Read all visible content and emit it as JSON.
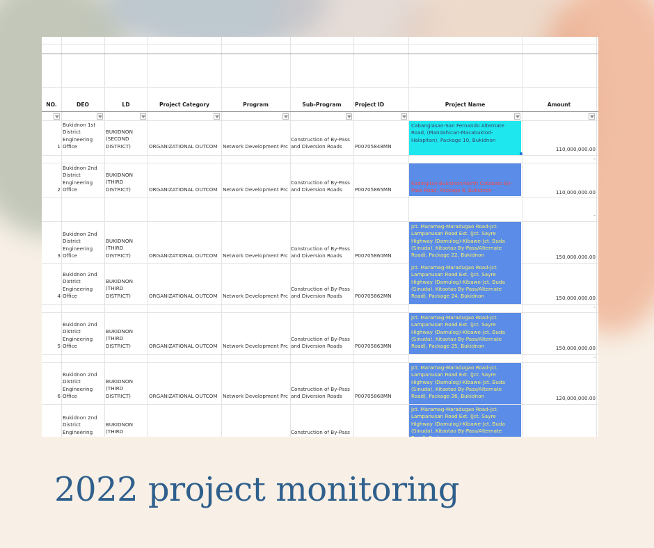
{
  "title": "2022 project monitoring",
  "colors": {
    "background": "#f8f0e6",
    "title": "#2f5f8c",
    "cyan_highlight": "#1ee8ee",
    "blue_highlight": "#5a8ce8",
    "yellow_text": "#fff36a",
    "red_text": "#f04b4b"
  },
  "sheet": {
    "headers": {
      "no": "NO.",
      "deo": "DEO",
      "ld": "LD",
      "category": "Project Category",
      "program": "Program",
      "subprogram": "Sub-Program",
      "project_id": "Project ID",
      "project_name": "Project Name",
      "amount": "Amount"
    },
    "separator": "-",
    "rows": [
      {
        "no": "1",
        "deo": "Bukidnon 1st\nDistrict\nEngineering\nOffice",
        "ld": "BUKIDNON\n(SECOND\nDISTRICT)",
        "category": "ORGANIZATIONAL OUTCOM",
        "program": "Network Development Prc",
        "subprogram": "Construction of By-Pass\nand Diversion Roads",
        "project_id": "P00705848MN",
        "project_name": "Cabanglasan-San Fernando Alternate Road, (Mandahican-Macabuklod-Halapitan), Package 10, Bukidnon",
        "amount": "110,000,000.00"
      },
      {
        "no": "2",
        "deo": "Bukidnon 2nd\nDistrict\nEngineering\nOffice",
        "ld": "BUKIDNON\n(THIRD\nDISTRICT)",
        "category": "ORGANIZATIONAL OUTCOM",
        "program": "Network Development Prc",
        "subprogram": "Construction of By-Pass\nand Diversion Roads",
        "project_id": "P00705865MN",
        "project_name": "Kadingilan-Bukidnon/North Cotabato By-Pass Road, Package 8, Bukidnon",
        "amount": "110,000,000.00"
      },
      {
        "no": "3",
        "deo": "Bukidnon 2nd\nDistrict\nEngineering\nOffice",
        "ld": "BUKIDNON\n(THIRD\nDISTRICT)",
        "category": "ORGANIZATIONAL OUTCOM",
        "program": "Network Development Prc",
        "subprogram": "Construction of By-Pass\nand Diversion Roads",
        "project_id": "P00705860MN",
        "project_name": "Jct. Maramag-Maradugao Road-Jct. Lampanusan Road Ext. (Jct. Sayre Highway (Damulog)-Kibawe-Jct. Buda (Sinuda), Kitaotao By-Pass/Alternate Road), Package 22, Bukidnon",
        "amount": "150,000,000.00"
      },
      {
        "no": "4",
        "deo": "Bukidnon 2nd\nDistrict\nEngineering\nOffice",
        "ld": "BUKIDNON\n(THIRD\nDISTRICT)",
        "category": "ORGANIZATIONAL OUTCOM",
        "program": "Network Development Prc",
        "subprogram": "Construction of By-Pass\nand Diversion Roads",
        "project_id": "P00705862MN",
        "project_name": "Jct. Maramag-Maradugao Road-Jct. Lampanusan Road Ext. (Jct. Sayre Highway (Damulog)-Kibawe-Jct. Buda (Sinuda), Kitaotao By-Pass/Alternate Road), Package 24, Bukidnon",
        "amount": "150,000,000.00"
      },
      {
        "no": "5",
        "deo": "Bukidnon 2nd\nDistrict\nEngineering\nOffice",
        "ld": "BUKIDNON\n(THIRD\nDISTRICT)",
        "category": "ORGANIZATIONAL OUTCOM",
        "program": "Network Development Prc",
        "subprogram": "Construction of By-Pass\nand Diversion Roads",
        "project_id": "P00705863MN",
        "project_name": "Jct. Maramag-Maradugao Road-Jct. Lampanusan Road Ext. (Jct. Sayre Highway (Damulog)-Kibawe-Jct. Buda (Sinuda), Kitaotao By-Pass/Alternate Road), Package 25, Bukidnon",
        "amount": "150,000,000.00"
      },
      {
        "no": "6",
        "deo": "Bukidnon 2nd\nDistrict\nEngineering\nOffice",
        "ld": "BUKIDNON\n(THIRD\nDISTRICT)",
        "category": "ORGANIZATIONAL OUTCOM",
        "program": "Network Development Prc",
        "subprogram": "Construction of By-Pass\nand Diversion Roads",
        "project_id": "P00705868MN",
        "project_name": "Jct. Maramag-Maradugao Road-Jct. Lampanusan Road Ext. (Jct. Sayre Highway (Damulog)-Kibawe-Jct. Buda (Sinuda), Kitaotao By-Pass/Alternate Road), Package 26, Bukidnon",
        "amount": "120,000,000.00"
      },
      {
        "no": "",
        "deo": "Bukidnon 2nd\nDistrict\nEngineering",
        "ld": "BUKIDNON\n(THIRD",
        "category": "",
        "program": "",
        "subprogram": "Construction of By-Pass",
        "project_id": "",
        "project_name": "Jct. Maramag-Maradugao Road-Jct. Lampanusan Road Ext. (Jct. Sayre Highway (Damulog)-Kibawe-Jct. Buda (Sinuda), Kitaotao By-Pass/Alternate Road), Package",
        "amount": ""
      }
    ]
  }
}
